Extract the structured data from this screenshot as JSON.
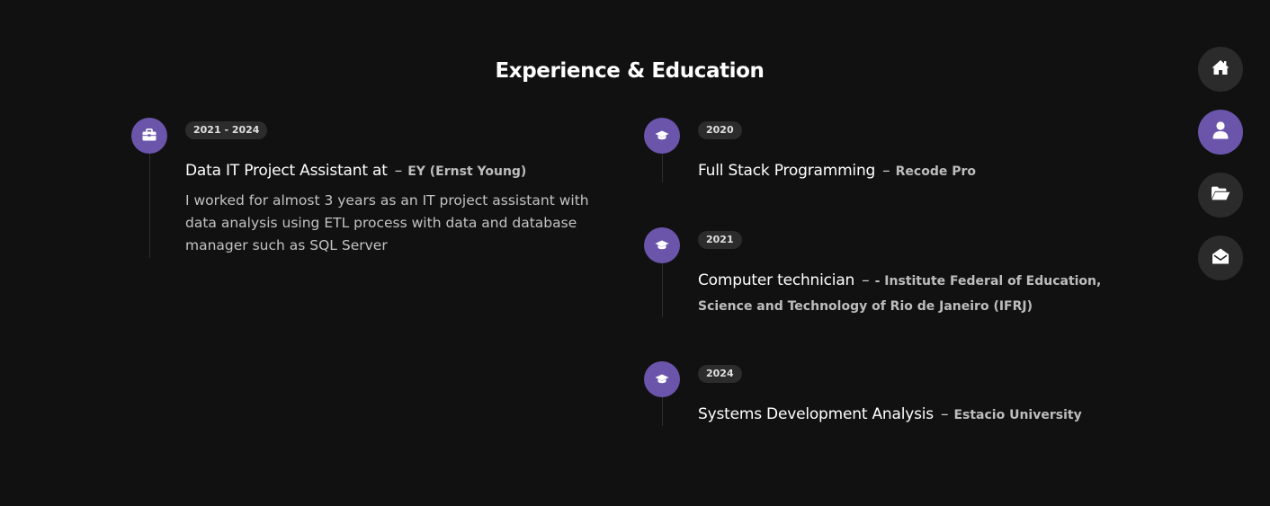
{
  "section": {
    "title": "Experience & Education"
  },
  "experience": [
    {
      "year": "2021 - 2024",
      "title": "Data IT Project Assistant at",
      "separator": "–",
      "organization": "EY (Ernst Young)",
      "description": "I worked for almost 3 years as an IT project assistant with data analysis using ETL process with data and database manager such as SQL Server",
      "icon": "briefcase-icon"
    }
  ],
  "education": [
    {
      "year": "2020",
      "title": "Full Stack Programming",
      "separator": "–",
      "organization": "Recode Pro",
      "icon": "graduation-cap-icon"
    },
    {
      "year": "2021",
      "title": "Computer technician",
      "separator": "–",
      "organization": "- Institute Federal of Education,",
      "organization_line2": "Science and Technology of Rio de Janeiro (IFRJ)",
      "icon": "graduation-cap-icon"
    },
    {
      "year": "2024",
      "title": "Systems Development Analysis",
      "separator": "–",
      "organization": "Estacio University",
      "icon": "graduation-cap-icon"
    }
  ],
  "nav": {
    "items": [
      {
        "name": "home",
        "icon": "home-icon",
        "active": false
      },
      {
        "name": "about",
        "icon": "user-icon",
        "active": true
      },
      {
        "name": "portfolio",
        "icon": "folder-open-icon",
        "active": false
      },
      {
        "name": "contact",
        "icon": "envelope-open-icon",
        "active": false
      }
    ]
  },
  "colors": {
    "background": "#111111",
    "accent": "#6a55ab",
    "badge": "#2c2c2c",
    "nav_button": "#2b2b2b"
  }
}
